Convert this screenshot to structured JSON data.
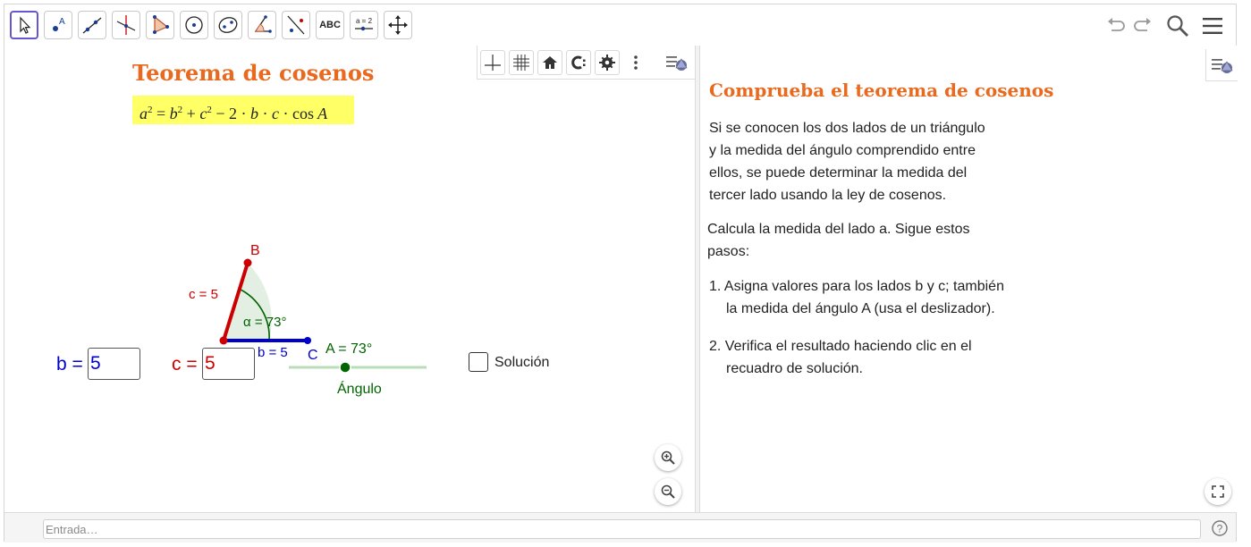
{
  "toolbar": {
    "tools": [
      {
        "name": "move-tool",
        "icon": "cursor-arrow-icon"
      },
      {
        "name": "point-tool",
        "icon": "point-icon",
        "label": "A"
      },
      {
        "name": "line-tool",
        "icon": "line-icon"
      },
      {
        "name": "perpendicular-line-tool",
        "icon": "perpendicular-line-icon"
      },
      {
        "name": "polygon-tool",
        "icon": "polygon-icon"
      },
      {
        "name": "circle-tool",
        "icon": "circle-center-point-icon"
      },
      {
        "name": "ellipse-tool",
        "icon": "ellipse-icon"
      },
      {
        "name": "angle-tool",
        "icon": "angle-icon"
      },
      {
        "name": "reflect-tool",
        "icon": "reflect-about-line-icon"
      },
      {
        "name": "text-tool",
        "icon": "text-icon",
        "label": "ABC"
      },
      {
        "name": "slider-tool",
        "icon": "slider-icon",
        "label": "a = 2"
      },
      {
        "name": "move-graphics-view-tool",
        "icon": "move-arrows-icon"
      }
    ],
    "right": [
      "undo-icon",
      "redo-icon",
      "search-icon",
      "menu-icon"
    ]
  },
  "graphics": {
    "style_bar": [
      "axes-icon",
      "grid-icon",
      "home-icon",
      "point-capturing-icon",
      "gear-icon",
      "more-vertical-icon",
      "toggle-style-bar-icon"
    ],
    "title": "Teorema de cosenos",
    "formula": {
      "a": "a",
      "b": "b",
      "c": "c",
      "exp": "2",
      "minus_two": "2",
      "cdot": "·",
      "cos": "cos",
      "A": "A",
      "eq": "=",
      "plus": "+",
      "minus": "−"
    },
    "triangle": {
      "label_B": "B",
      "label_C": "C",
      "side_c_label": "c = 5",
      "side_b_label": "b = 5",
      "angle_label": "α = 73°",
      "colors": {
        "side_c": "#cc0000",
        "side_b": "#0000cc",
        "angle_fill": "#e3efe3",
        "angle_stroke": "#006400"
      }
    },
    "slider": {
      "label": "A = 73°",
      "caption": "Ángulo",
      "value_deg": 73,
      "min_deg": 0,
      "max_deg": 180,
      "color": "#006400",
      "track_color": "#b9dcb9"
    },
    "input_b": {
      "label": "b =",
      "value": "5",
      "color": "#0000cc"
    },
    "input_c": {
      "label": "c =",
      "value": "5",
      "color": "#cc0000"
    },
    "checkbox": {
      "label": "Solución",
      "checked": false
    },
    "zoom": [
      "zoom-in-icon",
      "zoom-out-icon"
    ]
  },
  "algebra": {
    "title": "Comprueba el teorema de cosenos",
    "intro": [
      "Si se conocen los dos lados de un triángulo",
      "y la medida del ángulo comprendido entre",
      "ellos, se puede determinar la medida del",
      "tercer lado usando la ley de cosenos."
    ],
    "calc": [
      "Calcula la medida del lado a. Sigue estos",
      "pasos:"
    ],
    "steps": [
      {
        "num": "1.",
        "lines": [
          "Asigna valores para los lados b y c; también",
          "la medida del ángulo A (usa el deslizador)."
        ]
      },
      {
        "num": "2.",
        "lines": [
          "Verifica el resultado haciendo clic en el",
          "recuadro de solución."
        ]
      }
    ],
    "icons": [
      "toggle-style-bar-icon",
      "fullscreen-icon"
    ]
  },
  "input_bar": {
    "placeholder": "Entrada…",
    "help_icon": "help-icon"
  },
  "colors": {
    "accent": "#6557d2",
    "title": "#e9691e",
    "formula_bg": "#ffff66"
  }
}
